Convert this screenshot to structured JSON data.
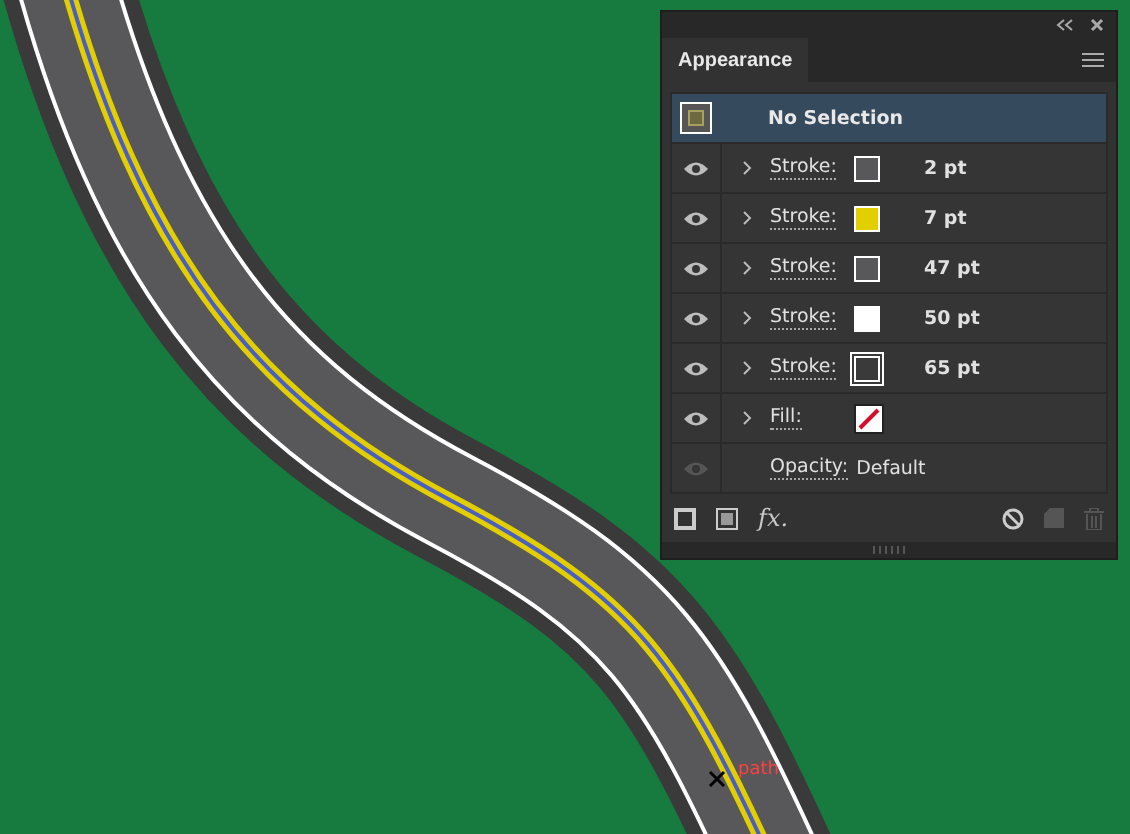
{
  "panel": {
    "tab": "Appearance",
    "header": "No Selection",
    "rows": [
      {
        "kind": "stroke",
        "label": "Stroke:",
        "value": "2 pt",
        "color": "#58585a",
        "visible": true
      },
      {
        "kind": "stroke",
        "label": "Stroke:",
        "value": "7 pt",
        "color": "#e3cf00",
        "visible": true
      },
      {
        "kind": "stroke",
        "label": "Stroke:",
        "value": "47 pt",
        "color": "#58585a",
        "visible": true
      },
      {
        "kind": "stroke",
        "label": "Stroke:",
        "value": "50 pt",
        "color": "#ffffff",
        "visible": true
      },
      {
        "kind": "stroke-outline",
        "label": "Stroke:",
        "value": "65 pt",
        "color": "#3a3a3a",
        "visible": true
      },
      {
        "kind": "fill",
        "label": "Fill:",
        "visible": true
      },
      {
        "kind": "opacity",
        "label": "Opacity:",
        "value": "Default",
        "visible": false
      }
    ],
    "toolbar": [
      "fx."
    ]
  },
  "canvas": {
    "path_label": "path"
  }
}
